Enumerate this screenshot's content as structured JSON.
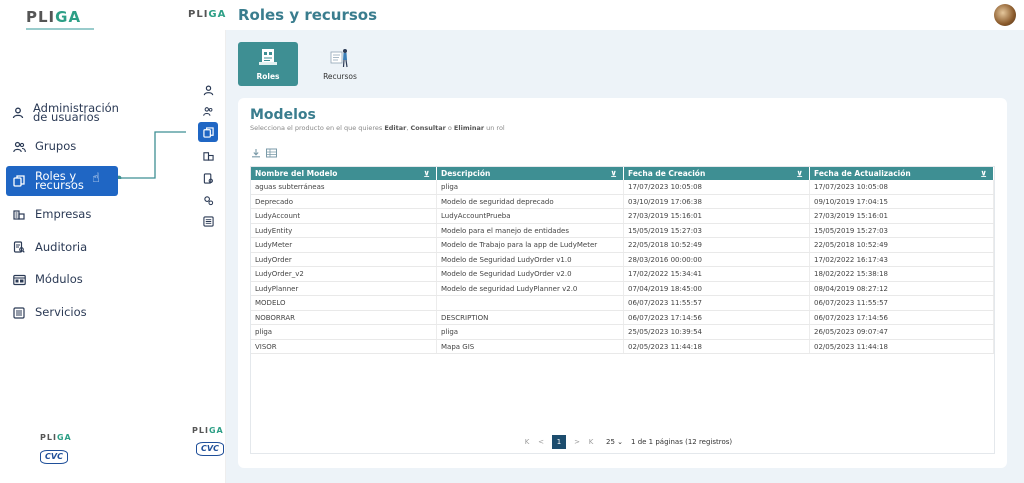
{
  "brand": {
    "name_a": "PLI",
    "name_b": "GA"
  },
  "left_menu": {
    "items": [
      {
        "label_1": "Administración",
        "label_2": "de usuarios",
        "icon": "user-icon"
      },
      {
        "label_1": "Grupos",
        "label_2": "",
        "icon": "users-icon"
      },
      {
        "label_1": "Roles y",
        "label_2": "recursos",
        "icon": "copy-icon"
      },
      {
        "label_1": "Empresas",
        "label_2": "",
        "icon": "building-icon"
      },
      {
        "label_1": "Auditoria",
        "label_2": "",
        "icon": "audit-icon"
      },
      {
        "label_1": "Módulos",
        "label_2": "",
        "icon": "modules-icon"
      },
      {
        "label_1": "Servicios",
        "label_2": "",
        "icon": "services-icon"
      }
    ],
    "active_index": 2
  },
  "footer": {
    "cvc": "CVC"
  },
  "header": {
    "title": "Roles y recursos"
  },
  "tabs": [
    {
      "label": "Roles",
      "active": true
    },
    {
      "label": "Recursos",
      "active": false
    }
  ],
  "card": {
    "title": "Modelos",
    "subtitle_pre": "Selecciona el producto en el que quieres ",
    "subtitle_editar": "Editar",
    "subtitle_sep1": ", ",
    "subtitle_consultar": "Consultar",
    "subtitle_sep2": " o ",
    "subtitle_eliminar": "Eliminar",
    "subtitle_post": " un rol"
  },
  "table": {
    "columns": [
      "Nombre del Modelo",
      "Descripción",
      "Fecha de Creación",
      "Fecha de Actualización"
    ],
    "rows": [
      [
        "aguas subterráneas",
        "pliga",
        "17/07/2023 10:05:08",
        "17/07/2023 10:05:08"
      ],
      [
        "Deprecado",
        "Modelo de seguridad deprecado",
        "03/10/2019 17:06:38",
        "09/10/2019 17:04:15"
      ],
      [
        "LudyAccount",
        "LudyAccountPrueba",
        "27/03/2019 15:16:01",
        "27/03/2019 15:16:01"
      ],
      [
        "LudyEntity",
        "Modelo para el manejo de entidades",
        "15/05/2019 15:27:03",
        "15/05/2019 15:27:03"
      ],
      [
        "LudyMeter",
        "Modelo de Trabajo para la app de LudyMeter",
        "22/05/2018 10:52:49",
        "22/05/2018 10:52:49"
      ],
      [
        "LudyOrder",
        "Modelo de Seguridad LudyOrder v1.0",
        "28/03/2016 00:00:00",
        "17/02/2022 16:17:43"
      ],
      [
        "LudyOrder_v2",
        "Modelo de Seguridad LudyOrder v2.0",
        "17/02/2022 15:34:41",
        "18/02/2022 15:38:18"
      ],
      [
        "LudyPlanner",
        "Modelo de seguridad LudyPlanner v2.0",
        "07/04/2019 18:45:00",
        "08/04/2019 08:27:12"
      ],
      [
        "MODELO",
        "",
        "06/07/2023 11:55:57",
        "06/07/2023 11:55:57"
      ],
      [
        "NOBORRAR",
        "DESCRIPTION",
        "06/07/2023 17:14:56",
        "06/07/2023 17:14:56"
      ],
      [
        "pliga",
        "pliga",
        "25/05/2023 10:39:54",
        "26/05/2023 09:07:47"
      ],
      [
        "VISOR",
        "Mapa GIS",
        "02/05/2023 11:44:18",
        "02/05/2023 11:44:18"
      ]
    ]
  },
  "pagination": {
    "current": "1",
    "page_size": "25",
    "info": "1 de 1 páginas (12 registros)",
    "first": "K",
    "prev": "<",
    "next": ">",
    "last": "K",
    "dropdown": "⌄"
  },
  "colors": {
    "accent": "#3e8f93",
    "active_menu": "#1f66c4",
    "title": "#3a7d8e"
  }
}
